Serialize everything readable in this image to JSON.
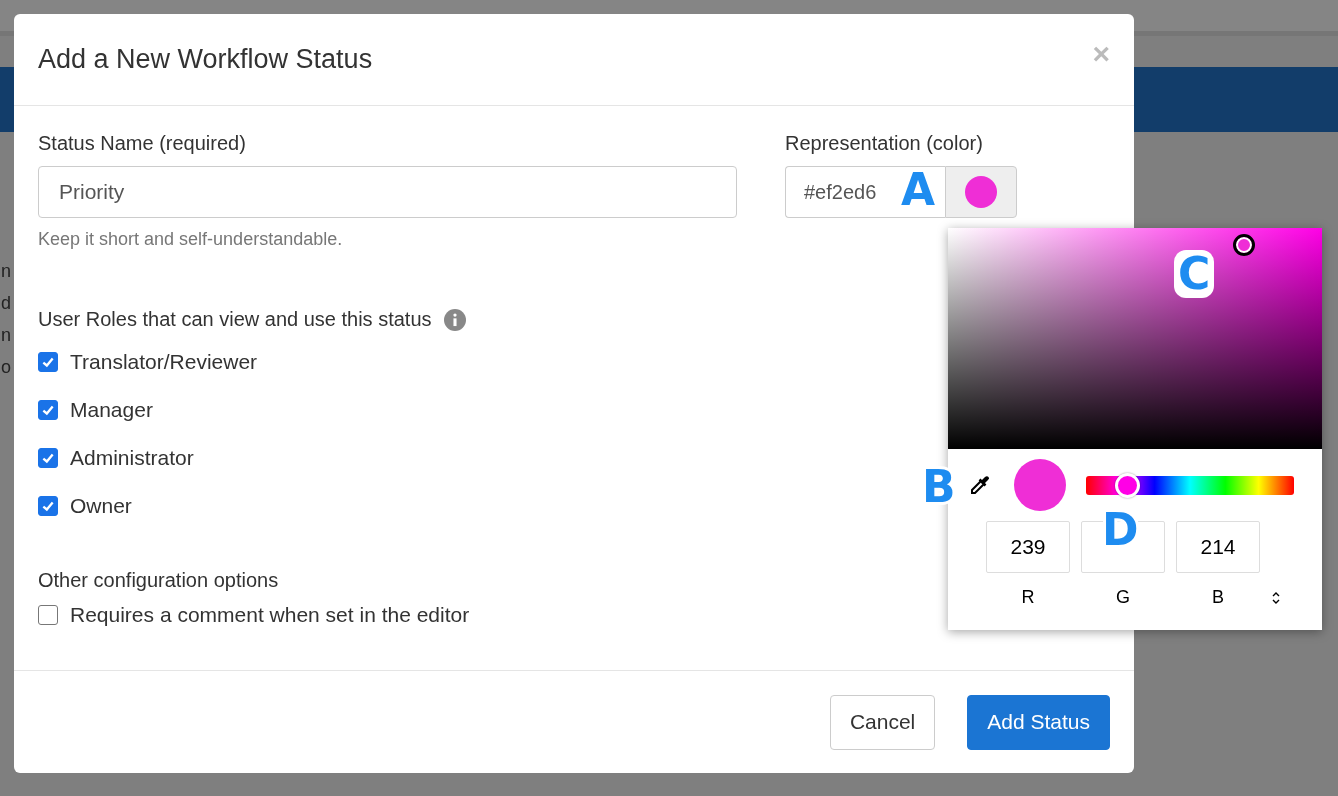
{
  "background": {
    "edge_text": [
      "n",
      "d",
      "n",
      "o"
    ]
  },
  "dialog": {
    "title": "Add a New Workflow Status",
    "close": "×",
    "status_name": {
      "label": "Status Name (required)",
      "value": "Priority",
      "help": "Keep it short and self-understandable."
    },
    "representation": {
      "label": "Representation (color)",
      "value": "#ef2ed6"
    },
    "roles": {
      "label": "User Roles that can view and use this status",
      "items": [
        {
          "label": "Translator/Reviewer",
          "checked": true
        },
        {
          "label": "Manager",
          "checked": true
        },
        {
          "label": "Administrator",
          "checked": true
        },
        {
          "label": "Owner",
          "checked": true
        }
      ]
    },
    "other": {
      "label": "Other configuration options",
      "items": [
        {
          "label": "Requires a comment when set in the editor",
          "checked": false
        }
      ]
    },
    "buttons": [
      {
        "label": "Cancel",
        "kind": "secondary"
      },
      {
        "label": "Add Status",
        "kind": "primary"
      }
    ]
  },
  "color_picker": {
    "hue": {
      "level": 0.15
    },
    "fields": [
      {
        "value": "239",
        "label": "R"
      },
      {
        "label": "G"
      },
      {
        "value": "214",
        "label": "B"
      }
    ]
  },
  "callouts": [
    "A",
    "B",
    "C",
    "D"
  ]
}
